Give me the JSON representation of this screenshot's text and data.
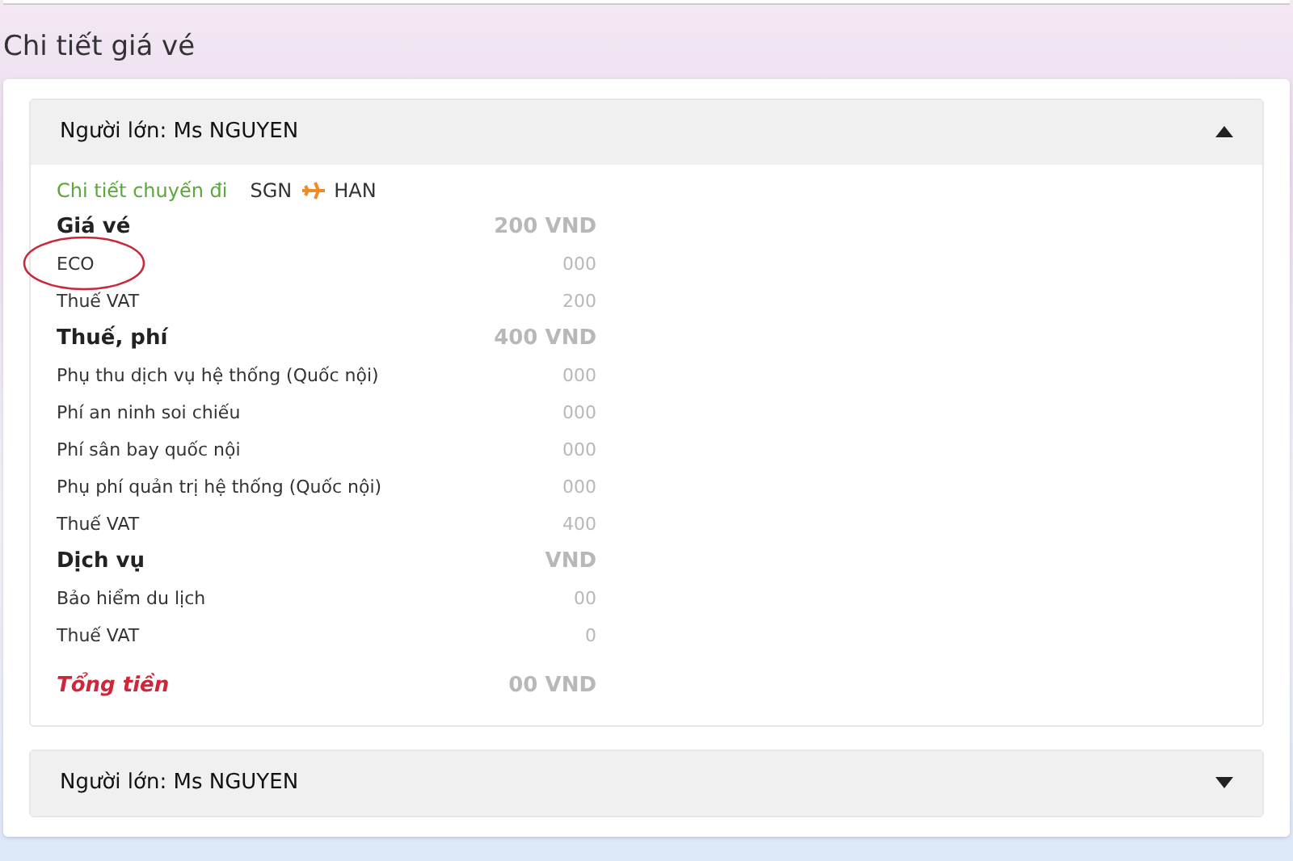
{
  "page_title": "Chi tiết giá vé",
  "passengers": [
    {
      "name": "Người lớn: Ms NGUYEN",
      "expanded": true,
      "trip": {
        "label": "Chi tiết chuyến đi",
        "from": "SGN",
        "to": "HAN"
      },
      "rows": [
        {
          "kind": "group",
          "label": "Giá vé",
          "value": "200 VND",
          "circled": false
        },
        {
          "kind": "item",
          "label": "ECO",
          "value": "000",
          "circled": true
        },
        {
          "kind": "item",
          "label": "Thuế VAT",
          "value": "200",
          "circled": false
        },
        {
          "kind": "group",
          "label": "Thuế, phí",
          "value": "400 VND",
          "circled": false
        },
        {
          "kind": "item",
          "label": "Phụ thu dịch vụ hệ thống (Quốc nội)",
          "value": "000",
          "circled": false
        },
        {
          "kind": "item",
          "label": "Phí an ninh soi chiếu",
          "value": "000",
          "circled": false
        },
        {
          "kind": "item",
          "label": "Phí sân bay quốc nội",
          "value": "000",
          "circled": false
        },
        {
          "kind": "item",
          "label": "Phụ phí quản trị hệ thống (Quốc nội)",
          "value": "000",
          "circled": false
        },
        {
          "kind": "item",
          "label": "Thuế VAT",
          "value": "400",
          "circled": false
        },
        {
          "kind": "group",
          "label": "Dịch vụ",
          "value": "VND",
          "circled": false
        },
        {
          "kind": "item",
          "label": "Bảo hiểm du lịch",
          "value": "00",
          "circled": false
        },
        {
          "kind": "item",
          "label": "Thuế VAT",
          "value": "0",
          "circled": false
        },
        {
          "kind": "total",
          "label": "Tổng tiền",
          "value": "00 VND",
          "circled": false
        }
      ]
    },
    {
      "name": "Người lớn: Ms NGUYEN",
      "expanded": false
    }
  ]
}
